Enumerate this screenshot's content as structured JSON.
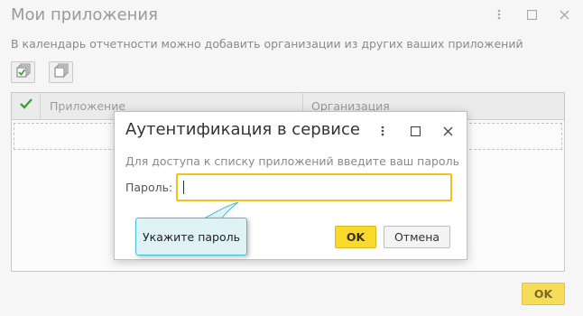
{
  "outer_window": {
    "title": "Мои приложения",
    "description": "В календарь отчетности можно добавить организации из других ваших приложений",
    "table": {
      "columns": [
        "Приложение",
        "Организация"
      ],
      "rows": []
    },
    "ok_label": "OK"
  },
  "dialog": {
    "title": "Аутентификация в сервисе",
    "hint": "Для доступа к списку приложений введите ваш пароль",
    "password_label": "Пароль:",
    "password_value": "",
    "ok_label": "OK",
    "cancel_label": "Отмена"
  },
  "tooltip": {
    "text": "Укажите пароль"
  },
  "colors": {
    "accent_yellow": "#f9d92c",
    "input_focus_border": "#f1c21b",
    "tooltip_bg": "#dff3f7",
    "tooltip_border": "#46bcd0",
    "check_green": "#3aa13a"
  },
  "icons": {
    "window_controls": [
      "more-vertical-icon",
      "maximize-icon",
      "close-icon"
    ],
    "toolbar": [
      "check-all-icon",
      "uncheck-all-icon"
    ],
    "column_header": "checkmark-icon"
  }
}
